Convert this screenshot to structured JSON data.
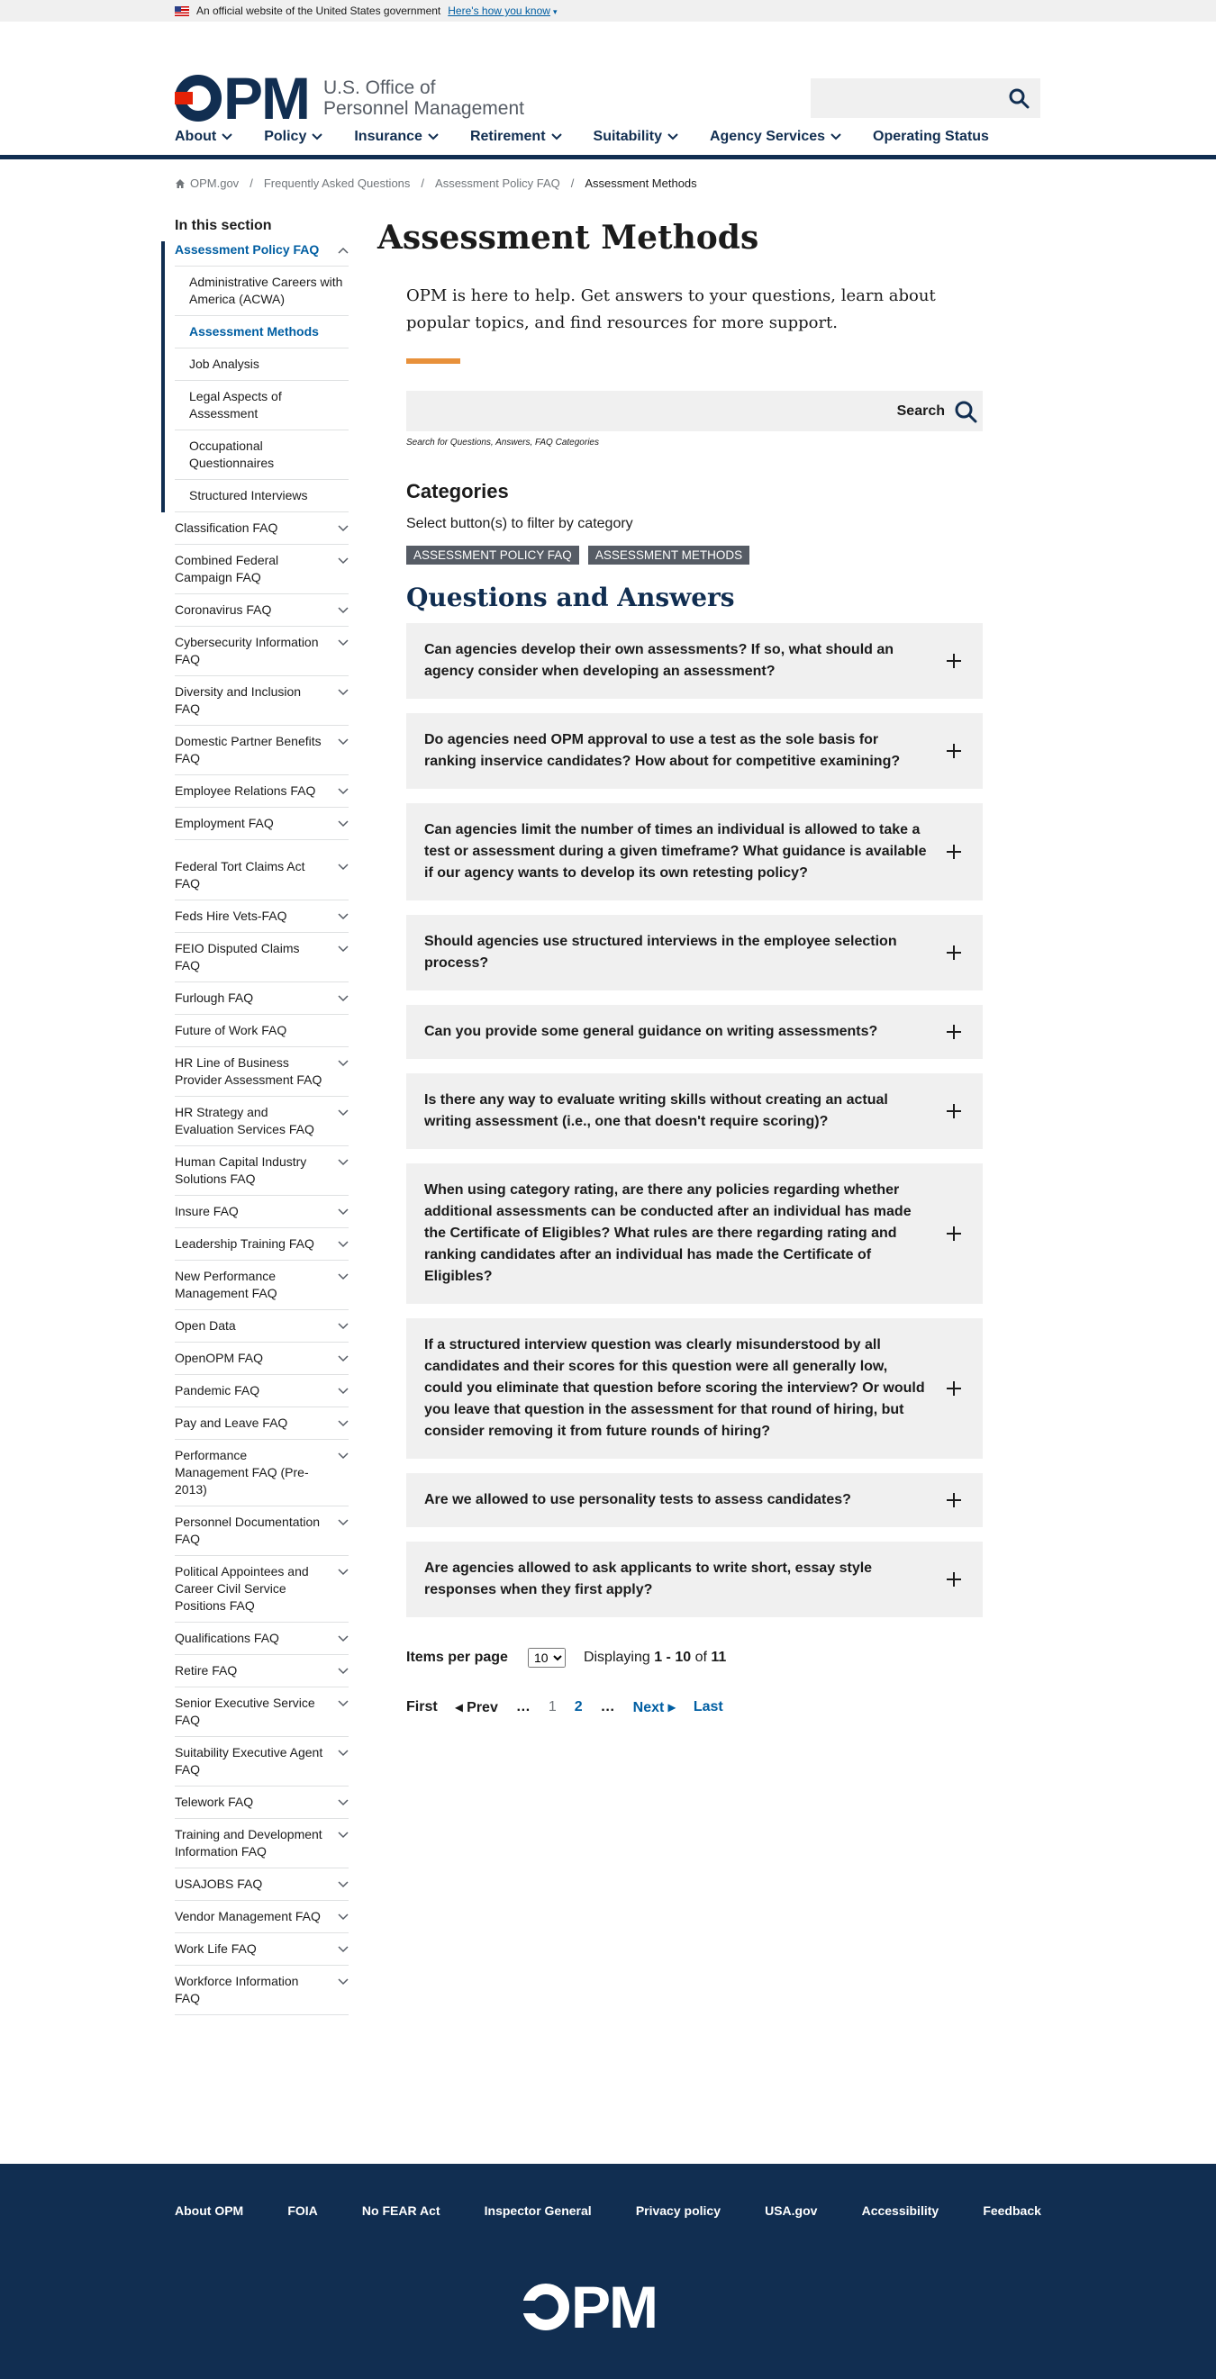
{
  "gov_banner": {
    "text": "An official website of the United States government",
    "link": "Here's how you know"
  },
  "header": {
    "logo_mark": "PM",
    "logo_line1": "U.S. Office of",
    "logo_line2": "Personnel Management"
  },
  "nav": [
    "About",
    "Policy",
    "Insurance",
    "Retirement",
    "Suitability",
    "Agency Services",
    "Operating Status"
  ],
  "breadcrumb": [
    "OPM.gov",
    "Frequently Asked Questions",
    "Assessment Policy FAQ",
    "Assessment Methods"
  ],
  "sidebar": {
    "title": "In this section",
    "active_group": "Assessment Policy FAQ",
    "sub_items": [
      "Administrative Careers with America (ACWA)",
      "Assessment Methods",
      "Job Analysis",
      "Legal Aspects of Assessment",
      "Occupational Questionnaires",
      "Structured Interviews"
    ],
    "items_a": [
      "Classification FAQ",
      "Combined Federal Campaign FAQ",
      "Coronavirus FAQ",
      "Cybersecurity Information FAQ",
      "Diversity and Inclusion FAQ",
      "Domestic Partner Benefits FAQ",
      "Employee Relations FAQ",
      "Employment FAQ"
    ],
    "items_b": [
      "Federal Tort Claims Act FAQ",
      "Feds Hire Vets-FAQ",
      "FEIO Disputed Claims FAQ",
      "Furlough FAQ",
      "Future of Work FAQ",
      "HR Line of Business Provider Assessment FAQ",
      "HR Strategy and Evaluation Services FAQ",
      "Human Capital Industry Solutions FAQ",
      "Insure FAQ",
      "Leadership Training FAQ",
      "New Performance Management FAQ",
      "Open Data",
      "OpenOPM FAQ",
      "Pandemic FAQ",
      "Pay and Leave FAQ",
      "Performance Management FAQ (Pre-2013)",
      "Personnel Documentation FAQ",
      "Political Appointees and Career Civil Service Positions FAQ",
      "Qualifications FAQ",
      "Retire FAQ",
      "Senior Executive Service FAQ",
      "Suitability Executive Agent FAQ",
      "Telework FAQ",
      "Training and Development Information FAQ",
      "USAJOBS FAQ",
      "Vendor Management FAQ",
      "Work Life FAQ",
      "Workforce Information FAQ"
    ]
  },
  "main": {
    "title": "Assessment Methods",
    "intro": "OPM is here to help. Get answers to your questions, learn about popular topics, and find resources for more support.",
    "search_button": "Search",
    "search_help": "Search for Questions, Answers, FAQ Categories",
    "categories_title": "Categories",
    "categories_sub": "Select button(s) to filter by category",
    "tags": [
      "ASSESSMENT POLICY FAQ",
      "ASSESSMENT METHODS"
    ],
    "qa_title": "Questions and Answers",
    "questions": [
      "Can agencies develop their own assessments? If so, what should an agency consider when developing an assessment?",
      "Do agencies need OPM approval to use a test as the sole basis for ranking inservice candidates? How about for competitive examining?",
      "Can agencies limit the number of times an individual is allowed to take a test or assessment during a given timeframe?  What guidance is available if our agency wants to develop its own retesting policy?",
      "Should agencies use structured interviews in the employee selection process?",
      "Can you provide some general guidance on writing assessments?",
      "Is there any way to evaluate writing skills without creating an actual writing assessment (i.e., one that doesn't require scoring)?",
      "When using category rating, are there any policies regarding whether additional assessments can be conducted after an individual has made the Certificate of Eligibles? What rules are there regarding rating and ranking candidates after an individual has made the Certificate of Eligibles?",
      "If a structured interview question was clearly misunderstood by all candidates and their scores for this question were all generally low, could you eliminate that question before scoring the interview? Or would you leave that question in the assessment for that round of hiring, but consider removing it from future rounds of hiring?",
      "Are we allowed to use personality tests to assess candidates?",
      "Are agencies allowed to ask applicants to write short, essay style responses when they first apply?"
    ],
    "per_page_label": "Items per page",
    "per_page_value": "10",
    "displaying_prefix": "Displaying ",
    "displaying_range": "1 - 10",
    "displaying_of": " of ",
    "displaying_total": "11",
    "pager": {
      "first": "First",
      "prev": "◂ Prev",
      "ellipsis1": "…",
      "page1": "1",
      "page2": "2",
      "ellipsis2": "…",
      "next": "Next ▸",
      "last": "Last"
    }
  },
  "footer": {
    "links": [
      "About OPM",
      "FOIA",
      "No FEAR Act",
      "Inspector General",
      "Privacy policy",
      "USA.gov",
      "Accessibility",
      "Feedback"
    ],
    "logo_mark": "PM"
  }
}
